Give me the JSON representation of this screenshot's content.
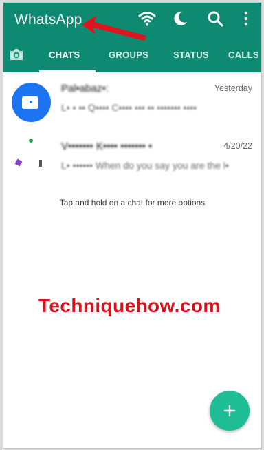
{
  "app": {
    "title": "WhatsApp"
  },
  "header": {
    "icons": [
      "wifi-icon",
      "moon-icon",
      "search-icon",
      "more-vertical-icon"
    ],
    "accent_color": "#0e8a73"
  },
  "tabs": [
    {
      "label": "CHATS",
      "active": true
    },
    {
      "label": "GROUPS",
      "active": false
    },
    {
      "label": "STATUS",
      "active": false
    },
    {
      "label": "CALLS",
      "active": false
    }
  ],
  "chats": [
    {
      "name": "Pal•abaz•:",
      "time": "Yesterday",
      "preview": "L• • •• Q•••• C•••• ••• •• ••••••• ••••",
      "avatar_color": "#1c74f0"
    },
    {
      "name": "V••••••• K•••• ••••••• •",
      "time": "4/20/22",
      "preview": "L• •••••• When do you say you are the l•",
      "avatar_color": "#ffffff"
    }
  ],
  "hint": "Tap and hold on a chat for more options",
  "watermark": "Techniquehow.com",
  "fab": {
    "icon": "plus-icon",
    "color": "#1ebd95"
  }
}
